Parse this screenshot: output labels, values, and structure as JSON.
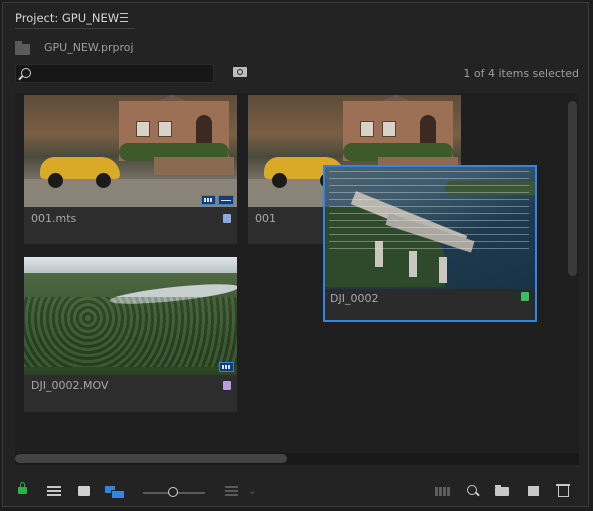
{
  "panel": {
    "title": "Project: GPU_NEW",
    "project_file": "GPU_NEW.prproj",
    "search": {
      "value": "",
      "placeholder": ""
    },
    "selection_status": "1 of 4 items selected"
  },
  "clips": [
    {
      "name": "001.mts",
      "label_color": "#8aa8e2"
    },
    {
      "name": "001",
      "label_color": "#8aa8e2"
    },
    {
      "name": "DJI_0002",
      "label_color": "#3cbf63",
      "selected": true
    },
    {
      "name": "DJI_0002.MOV",
      "label_color": "#b69ee0"
    }
  ],
  "toolbar": {
    "icons": [
      "lock-icon",
      "list-view-icon",
      "icon-view-icon",
      "freeform-view-icon",
      "zoom-slider",
      "sort-icon",
      "automate-to-sequence-icon",
      "find-icon",
      "new-bin-icon",
      "new-item-icon",
      "clear-icon"
    ]
  },
  "colors": {
    "accent": "#2f86e6",
    "lock": "#27b24a",
    "background": "#232323"
  }
}
